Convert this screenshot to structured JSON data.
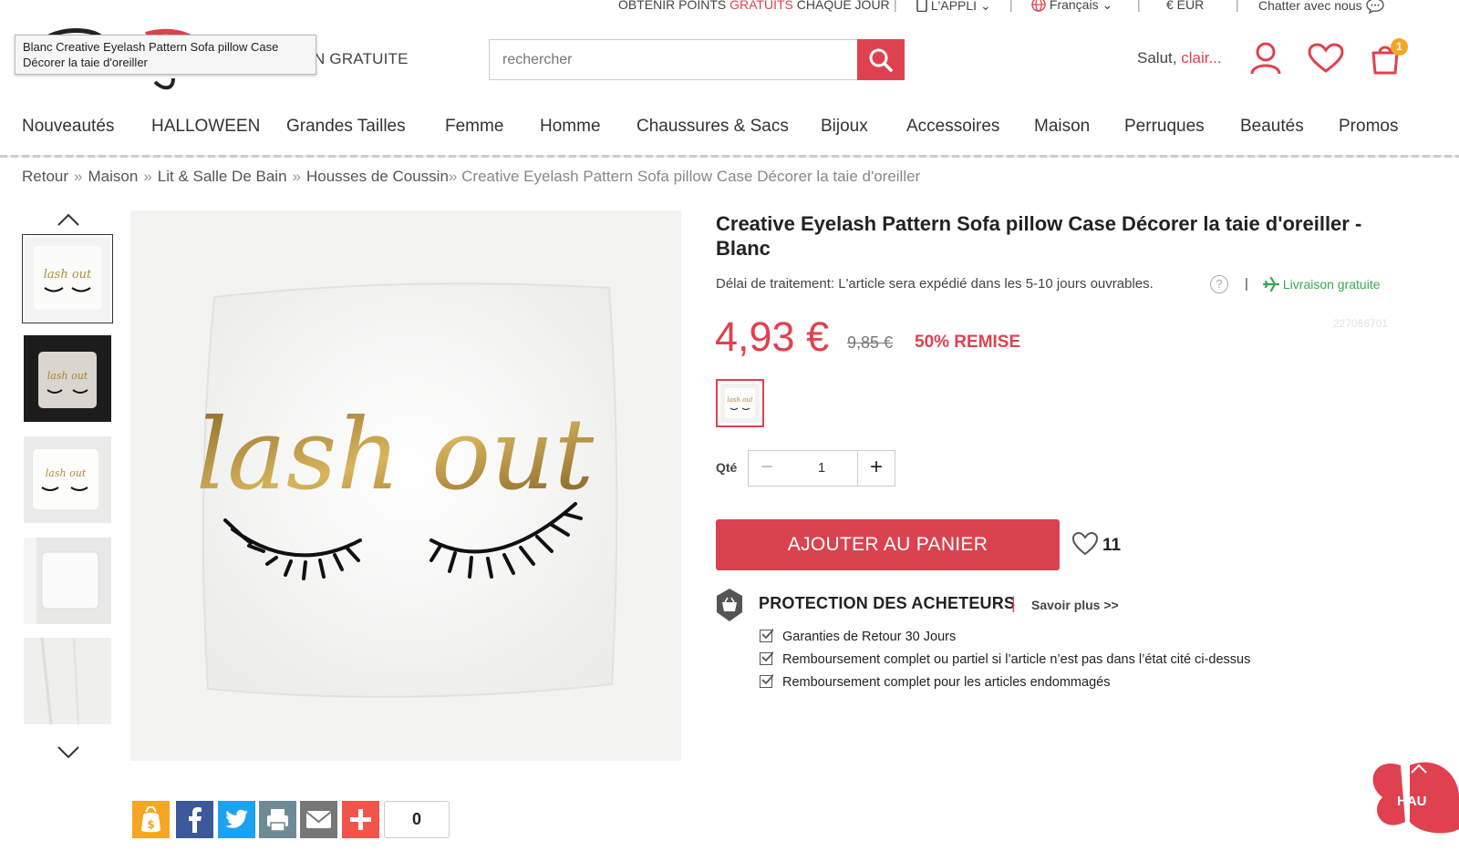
{
  "topbar": {
    "points_prefix": "OBTENIR POINTS",
    "points_highlight": "GRATUITS",
    "points_suffix": "CHAQUE JOUR",
    "app": "L'APPLI",
    "language": "Français",
    "currency": "€ EUR",
    "chat": "Chatter avec nous"
  },
  "tooltip": "Blanc Creative Eyelash Pattern Sofa pillow Case Décorer la taie d'oreiller",
  "header": {
    "free_shipping": "N GRATUITE",
    "search_placeholder": "rechercher",
    "greeting_prefix": "Salut,",
    "greeting_name": "clair...",
    "cart_count": "1"
  },
  "nav": [
    "Nouveautés",
    "HALLOWEEN",
    "Grandes Tailles",
    "Femme",
    "Homme",
    "Chaussures & Sacs",
    "Bijoux",
    "Accessoires",
    "Maison",
    "Perruques",
    "Beautés",
    "Promos"
  ],
  "breadcrumb": {
    "items": [
      "Retour",
      "Maison",
      "Lit & Salle De Bain",
      "Housses de Coussin"
    ],
    "current": "Creative Eyelash Pattern Sofa pillow Case Décorer la taie d'oreiller"
  },
  "product": {
    "title": "Creative Eyelash Pattern Sofa pillow Case Décorer la taie d'oreiller - Blanc",
    "processing": "Délai de traitement: L'article sera expédié dans les 5-10 jours ouvrables.",
    "help_icon": "?",
    "divider": "|",
    "free_delivery": "Livraison gratuite",
    "sku": "227066701",
    "price": "4,93 €",
    "old_price": "9,85 €",
    "discount": "50% REMISE",
    "qty_label": "Qté",
    "qty_minus": "−",
    "qty_plus": "+",
    "qty_value": "1",
    "add_to_cart": "AJOUTER AU PANIER",
    "wish_count": "11",
    "pillow_text": "lash out"
  },
  "protection": {
    "title": "PROTECTION DES ACHETEURS",
    "divider": "|",
    "more": "Savoir plus >>",
    "items": [
      "Garanties de Retour 30 Jours",
      "Remboursement complet ou partiel si l’article n’est pas dans l’état cité ci-dessus",
      "Remboursement complet pour les articles endommagés"
    ]
  },
  "share": {
    "count": "0"
  },
  "back_to_top": "HAU",
  "icons": [
    "search-icon",
    "user-icon",
    "heart-icon",
    "cart-icon",
    "phone-icon",
    "globe-icon",
    "chat-icon",
    "plane-icon",
    "shield-basket-icon",
    "money-icon",
    "facebook-icon",
    "twitter-icon",
    "print-icon",
    "mail-icon",
    "plus-icon"
  ],
  "colors": {
    "accent": "#e0414f",
    "green": "#3aa657",
    "badge": "#f5a623"
  }
}
